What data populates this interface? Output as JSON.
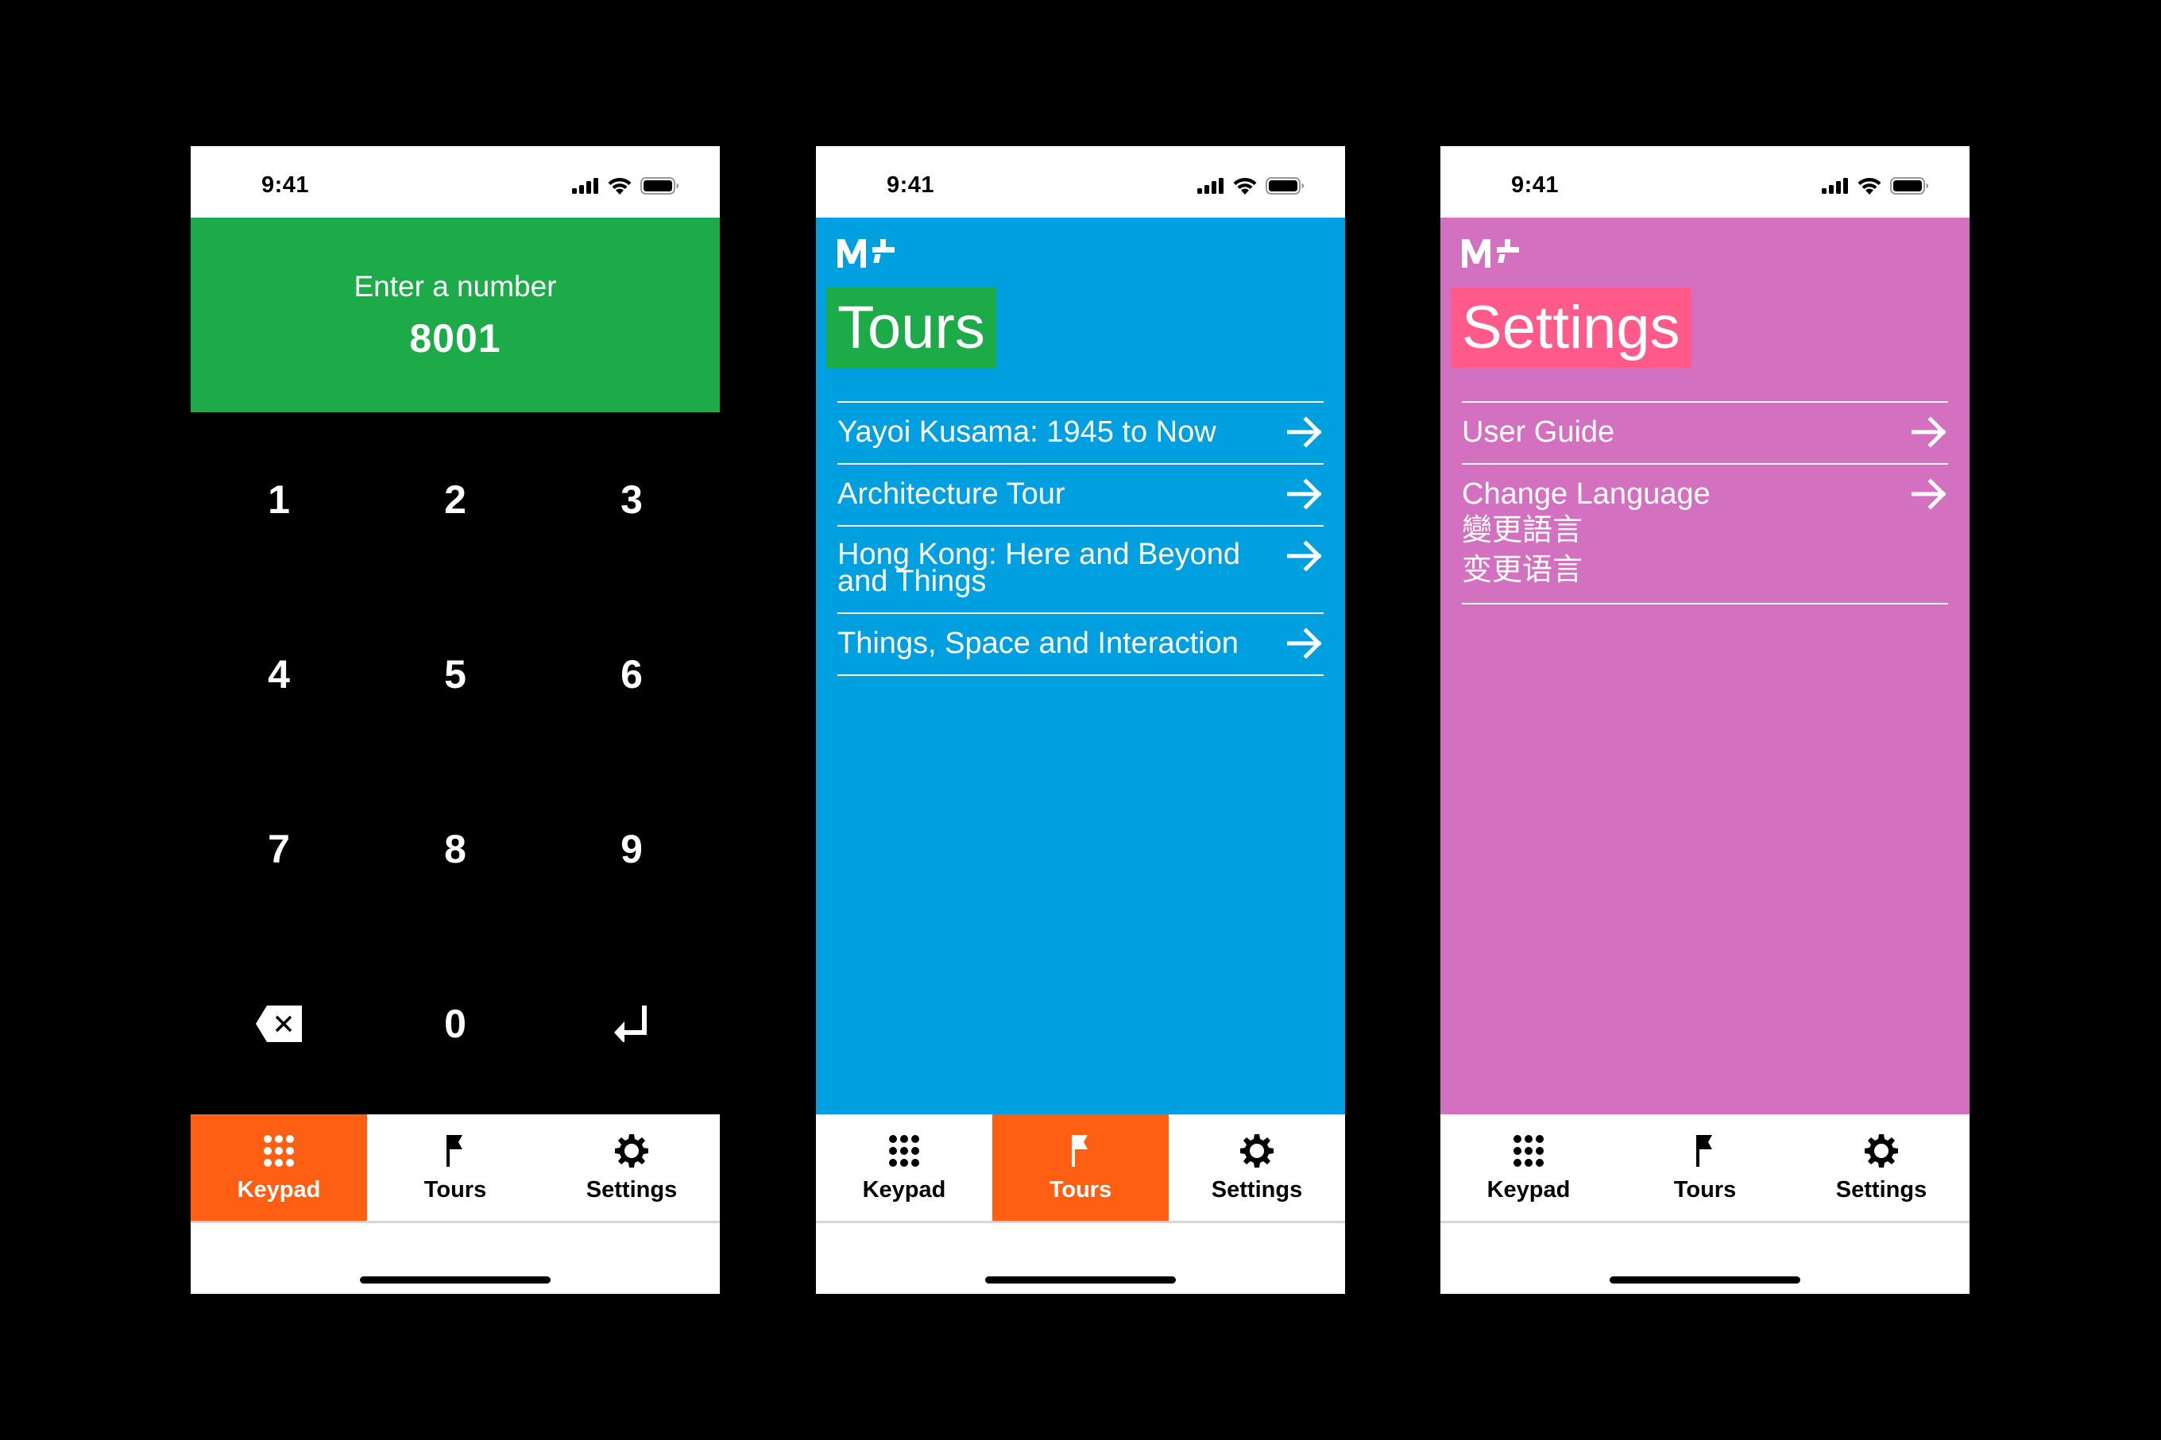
{
  "colors": {
    "background": "#000000",
    "keypad_header": "#1DAB4A",
    "tours_background": "#009FDF",
    "tours_title_highlight": "#1DAB4A",
    "settings_background": "#D370BF",
    "settings_title_highlight": "#FF5A89",
    "active_tab": "#FF5F12"
  },
  "status_bar": {
    "time": "9:41"
  },
  "brand": {
    "logo": "M+"
  },
  "tabs": [
    {
      "label": "Keypad",
      "icon": "keypad-dots-icon"
    },
    {
      "label": "Tours",
      "icon": "flag-icon"
    },
    {
      "label": "Settings",
      "icon": "gear-icon"
    }
  ],
  "keypad_screen": {
    "active_tab": "Keypad",
    "prompt": "Enter a number",
    "entered_value": "8001",
    "keys": [
      "1",
      "2",
      "3",
      "4",
      "5",
      "6",
      "7",
      "8",
      "9"
    ],
    "zero_key": "0",
    "backspace_icon": "backspace-icon",
    "enter_icon": "return-icon"
  },
  "tours_screen": {
    "active_tab": "Tours",
    "title": "Tours",
    "items": [
      {
        "label": "Yayoi Kusama: 1945 to Now"
      },
      {
        "label": "Architecture Tour"
      },
      {
        "label": "Hong Kong: Here and Beyond and Things"
      },
      {
        "label": "Things, Space and Interaction"
      }
    ]
  },
  "settings_screen": {
    "active_tab": "Settings",
    "title": "Settings",
    "items": [
      {
        "label": "User Guide"
      },
      {
        "label": "Change Language",
        "label_traditional_chinese": "變更語言",
        "label_simplified_chinese": "变更语言"
      }
    ]
  }
}
